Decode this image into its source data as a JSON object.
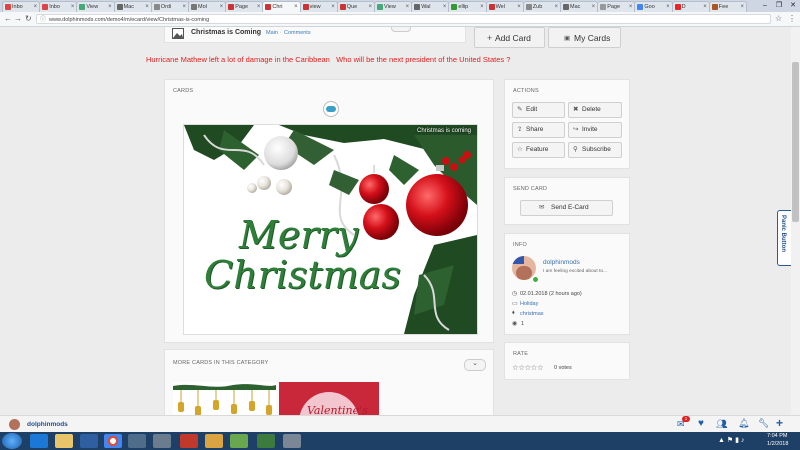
{
  "browser": {
    "tabs": [
      {
        "label": "Inbo",
        "color": "#d44"
      },
      {
        "label": "Inbo",
        "color": "#d44"
      },
      {
        "label": "View",
        "color": "#4a7"
      },
      {
        "label": "Mac",
        "color": "#666"
      },
      {
        "label": "Ordi",
        "color": "#888"
      },
      {
        "label": "Mol",
        "color": "#777"
      },
      {
        "label": "Page",
        "color": "#c33"
      },
      {
        "label": "Chri",
        "color": "#c33",
        "active": true
      },
      {
        "label": "view",
        "color": "#c33"
      },
      {
        "label": "Que",
        "color": "#c33"
      },
      {
        "label": "View",
        "color": "#4a7"
      },
      {
        "label": "Wal",
        "color": "#666"
      },
      {
        "label": "ellip",
        "color": "#393"
      },
      {
        "label": "Wel",
        "color": "#c33"
      },
      {
        "label": "Zub",
        "color": "#888"
      },
      {
        "label": "Mac",
        "color": "#666"
      },
      {
        "label": "Page",
        "color": "#999"
      },
      {
        "label": "Goo",
        "color": "#4285f4"
      },
      {
        "label": "D",
        "color": "#e22"
      },
      {
        "label": "Fee",
        "color": "#a52"
      }
    ],
    "url": "www.dolphinmods.com/demo4/m/ecard/view/Christmas-is-coming",
    "window_controls": [
      "–",
      "❐",
      "✕"
    ]
  },
  "header": {
    "card_title": "Christmas is Coming",
    "breadcrumb_main": "Main",
    "breadcrumb_sep": "·",
    "breadcrumb_comments": "Comments",
    "add_card": "Add Card",
    "my_cards": "My Cards"
  },
  "ticker": "Hurricane Mathew left a lot of damage in the Caribbean   Who will be the next president of the United States ?",
  "cards_panel": {
    "title": "CARDS",
    "image_caption": "Christmas is coming",
    "merry": "Merry",
    "christmas": "Christmas"
  },
  "actions": {
    "title": "ACTIONS",
    "edit": "Edit",
    "delete": "Delete",
    "share": "Share",
    "invite": "Invite",
    "feature": "Feature",
    "subscribe": "Subscribe"
  },
  "send_card": {
    "title": "SEND CARD",
    "button": "Send E-Card"
  },
  "info": {
    "title": "INFO",
    "author": "dolphinmods",
    "status": "I am feeling excited about to...",
    "date": "02.01.2018 (2 hours ago)",
    "category": "Holiday",
    "tag": "christmas",
    "views": "1"
  },
  "rate": {
    "title": "RATE",
    "stars": "☆☆☆☆☆",
    "votes": "0 votes"
  },
  "more_cards": {
    "title": "MORE CARDS IN THIS CATEGORY",
    "valentine_text": "Valentine's"
  },
  "panic_button": "Panic Button",
  "chat_bar": {
    "user": "dolphinmods",
    "notif_count": "1"
  },
  "taskbar": {
    "time": "7:04 PM",
    "date": "1/2/2018"
  }
}
